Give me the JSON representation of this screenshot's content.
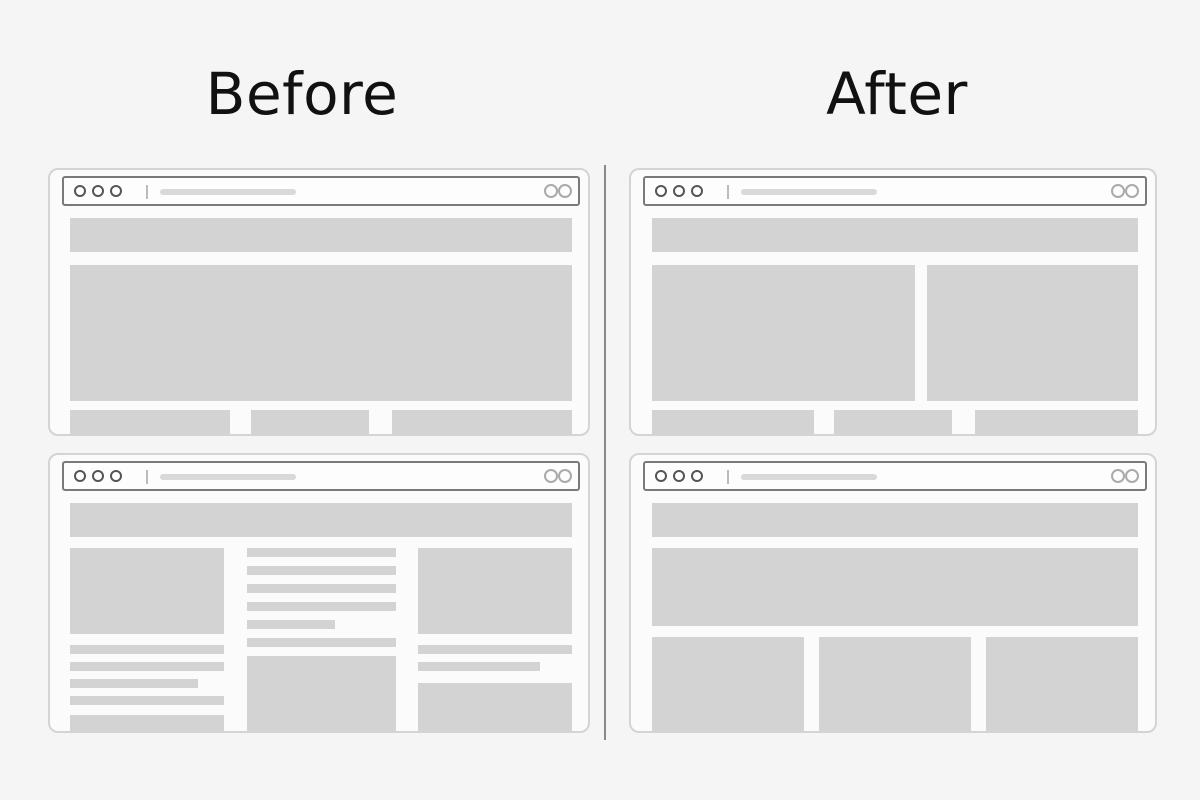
{
  "titles": {
    "before": "Before",
    "after": "After"
  },
  "colors": {
    "background": "#f5f5f5",
    "block": "#d3d3d4",
    "frame": "#7a7a7a",
    "divider": "#8a8a8a"
  },
  "browser_icons": [
    "window-dot-icon",
    "window-dot-icon",
    "window-dot-icon",
    "reload-icon",
    "menu-icon"
  ]
}
